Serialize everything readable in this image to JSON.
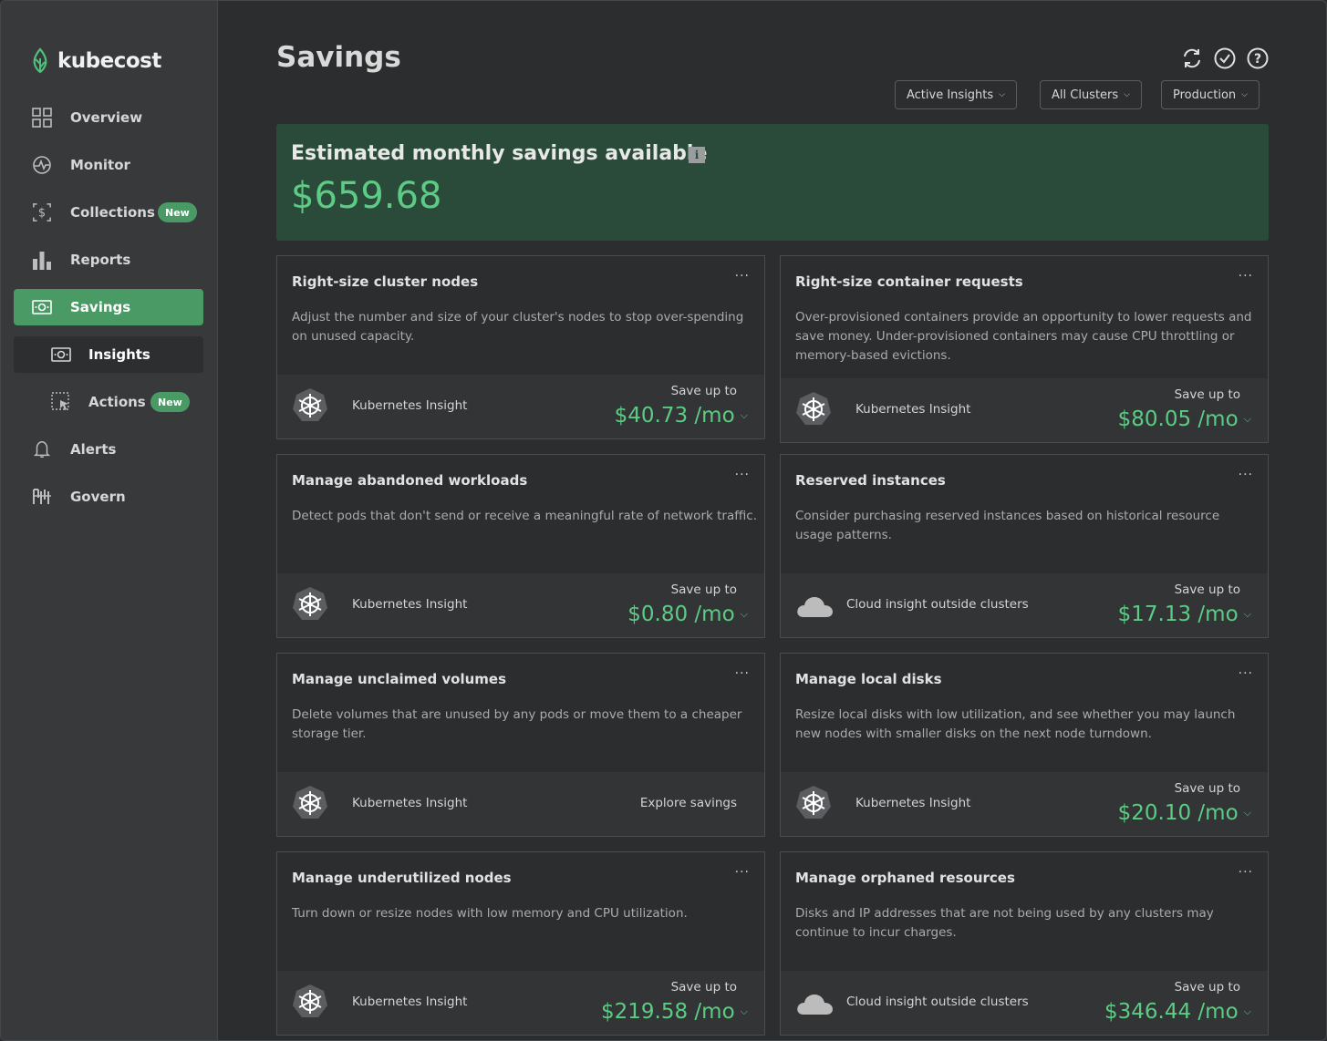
{
  "app": {
    "name": "kubecost"
  },
  "sidebar": {
    "items": [
      {
        "label": "Overview"
      },
      {
        "label": "Monitor"
      },
      {
        "label": "Collections",
        "badge": "New"
      },
      {
        "label": "Reports"
      },
      {
        "label": "Savings"
      },
      {
        "label": "Insights"
      },
      {
        "label": "Actions",
        "badge": "New"
      },
      {
        "label": "Alerts"
      },
      {
        "label": "Govern"
      }
    ]
  },
  "header": {
    "title": "Savings",
    "icons": [
      "refresh-icon",
      "check-circle-icon",
      "help-icon"
    ],
    "filters": [
      {
        "label": "Active Insights"
      },
      {
        "label": "All Clusters"
      },
      {
        "label": "Production"
      }
    ]
  },
  "banner": {
    "title": "Estimated monthly savings available",
    "info_icon": "i",
    "value": "$659.68"
  },
  "cards": [
    {
      "title": "Right-size cluster nodes",
      "menu": "...",
      "description": "Adjust the number and size of your cluster's nodes to stop over-spending on unused capacity.",
      "source": "Kubernetes Insight",
      "source_icon": "kubernetes-icon",
      "save_label": "Save up to",
      "amount": "$40.73 /mo"
    },
    {
      "title": "Right-size container requests",
      "menu": "...",
      "description": "Over-provisioned containers provide an opportunity to lower requests and save money. Under-provisioned containers may cause CPU throttling or memory-based evictions.",
      "source": "Kubernetes Insight",
      "source_icon": "kubernetes-icon",
      "save_label": "Save up to",
      "amount": "$80.05 /mo"
    },
    {
      "title": "Manage abandoned workloads",
      "menu": "...",
      "description": "Detect pods that don't send or receive a meaningful rate of network traffic.",
      "source": "Kubernetes Insight",
      "source_icon": "kubernetes-icon",
      "save_label": "Save up to",
      "amount": "$0.80 /mo"
    },
    {
      "title": "Reserved instances",
      "menu": "...",
      "description": "Consider purchasing reserved instances based on historical resource usage patterns.",
      "source": "Cloud insight outside clusters",
      "source_icon": "cloud-icon",
      "save_label": "Save up to",
      "amount": "$17.13 /mo"
    },
    {
      "title": "Manage unclaimed volumes",
      "menu": "...",
      "description": "Delete volumes that are unused by any pods or move them to a cheaper storage tier.",
      "source": "Kubernetes Insight",
      "source_icon": "kubernetes-icon",
      "action": "Explore savings"
    },
    {
      "title": "Manage local disks",
      "menu": "...",
      "description": "Resize local disks with low utilization, and see whether you may launch new nodes with smaller disks on the next node turndown.",
      "source": "Kubernetes Insight",
      "source_icon": "kubernetes-icon",
      "save_label": "Save up to",
      "amount": "$20.10 /mo"
    },
    {
      "title": "Manage underutilized nodes",
      "menu": "...",
      "description": "Turn down or resize nodes with low memory and CPU utilization.",
      "source": "Kubernetes Insight",
      "source_icon": "kubernetes-icon",
      "save_label": "Save up to",
      "amount": "$219.58 /mo"
    },
    {
      "title": "Manage orphaned resources",
      "menu": "...",
      "description": "Disks and IP addresses that are not being used by any clusters may continue to incur charges.",
      "source": "Cloud insight outside clusters",
      "source_icon": "cloud-icon",
      "save_label": "Save up to",
      "amount": "$346.44 /mo"
    }
  ],
  "colors": {
    "accent": "#4a9a66",
    "money": "#5ccc84",
    "banner_bg": "#2b4b3a"
  }
}
